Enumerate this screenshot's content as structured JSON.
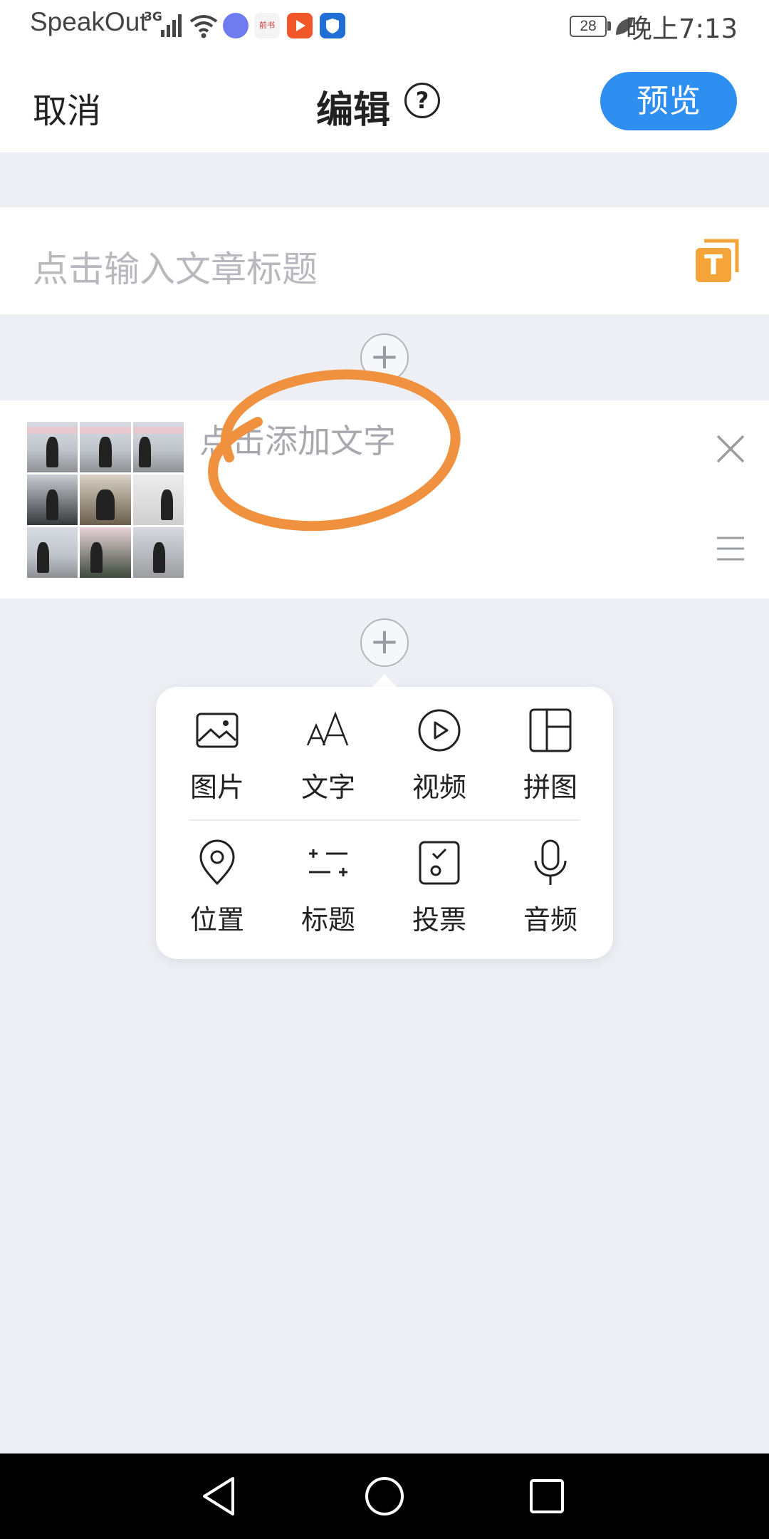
{
  "status_bar": {
    "carrier": "SpeakOut",
    "network": "3G",
    "battery": "28",
    "time": "晚上7:13",
    "app_badge_text": "前书"
  },
  "header": {
    "cancel_label": "取消",
    "title": "编辑",
    "help_icon": "?",
    "preview_label": "预览"
  },
  "title_row": {
    "placeholder": "点击输入文章标题",
    "style_icon": "T"
  },
  "add_icon": "+",
  "content_block": {
    "text_placeholder": "点击添加文字",
    "photo_count": 9
  },
  "colors": {
    "accent_blue": "#2f8ff0",
    "title_icon_orange": "#f5a43a",
    "annotation_orange": "#f0913f",
    "background": "#eeeff4"
  },
  "insert_menu": {
    "items": [
      {
        "label": "图片",
        "icon": "image-icon"
      },
      {
        "label": "文字",
        "icon": "text-icon"
      },
      {
        "label": "视频",
        "icon": "video-icon"
      },
      {
        "label": "拼图",
        "icon": "collage-icon"
      },
      {
        "label": "位置",
        "icon": "location-icon"
      },
      {
        "label": "标题",
        "icon": "heading-icon"
      },
      {
        "label": "投票",
        "icon": "vote-icon"
      },
      {
        "label": "音频",
        "icon": "audio-icon"
      }
    ]
  },
  "nav_bar": {
    "buttons": [
      "back-icon",
      "home-icon",
      "recents-icon"
    ]
  }
}
